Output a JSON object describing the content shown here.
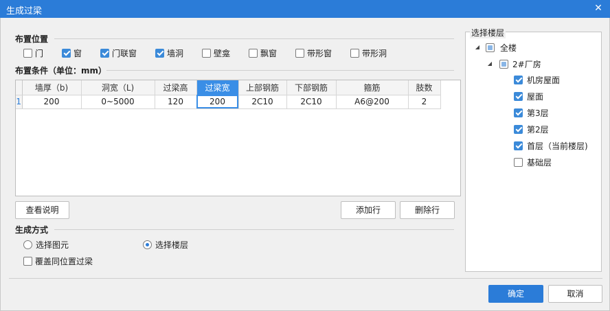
{
  "window": {
    "title": "生成过梁"
  },
  "placement": {
    "title": "布置位置",
    "options": [
      {
        "label": "门",
        "checked": false
      },
      {
        "label": "窗",
        "checked": true
      },
      {
        "label": "门联窗",
        "checked": true
      },
      {
        "label": "墙洞",
        "checked": true
      },
      {
        "label": "壁龛",
        "checked": false
      },
      {
        "label": "飘窗",
        "checked": false
      },
      {
        "label": "带形窗",
        "checked": false
      },
      {
        "label": "带形洞",
        "checked": false
      }
    ]
  },
  "conditions": {
    "title": "布置条件（单位：mm）",
    "columns": [
      "墙厚（b)",
      "洞宽（L)",
      "过梁高",
      "过梁宽",
      "上部钢筋",
      "下部钢筋",
      "箍筋",
      "肢数"
    ],
    "rows": [
      {
        "index": "1",
        "cells": [
          "200",
          "0~5000",
          "120",
          "200",
          "2C10",
          "2C10",
          "A6@200",
          "2"
        ]
      }
    ]
  },
  "buttons": {
    "view_help": "查看说明",
    "add_row": "添加行",
    "delete_row": "删除行",
    "ok": "确定",
    "cancel": "取消"
  },
  "generate": {
    "title": "生成方式",
    "select_element": "选择图元",
    "select_floor": "选择楼层",
    "selected": "select_floor",
    "overwrite_label": "覆盖同位置过梁",
    "overwrite_checked": false
  },
  "floors": {
    "title": "选择楼层",
    "root": "全楼",
    "building": "2#厂房",
    "items": [
      {
        "label": "机房屋面",
        "checked": true
      },
      {
        "label": "屋面",
        "checked": true
      },
      {
        "label": "第3层",
        "checked": true
      },
      {
        "label": "第2层",
        "checked": true
      },
      {
        "label": "首层（当前楼层)",
        "checked": true
      },
      {
        "label": "基础层",
        "checked": false
      }
    ]
  },
  "colors": {
    "accent": "#2b7cd8",
    "check": "#3b8ad9"
  }
}
